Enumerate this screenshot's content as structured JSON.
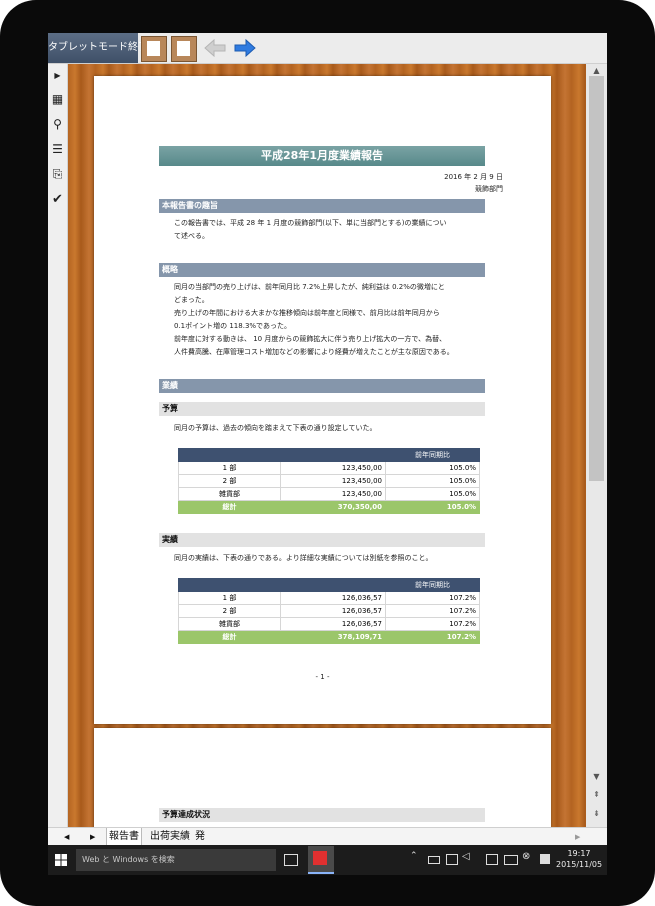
{
  "toolbar": {
    "tablet_mode_label": "タブレットモード終了"
  },
  "report": {
    "title": "平成28年1月度業績報告",
    "date": "2016 年 2 月 9 日",
    "department": "競飾部門",
    "section_purpose": {
      "heading": "本報告書の趣旨",
      "lines": [
        "この報告書では、平成 28 年 1 月度の競飾部門(以下、単に当部門とする)の業績につい",
        "て述べる。"
      ]
    },
    "section_summary": {
      "heading": "概略",
      "lines": [
        "同月の当部門の売り上げは、前年同月比 7.2%上昇したが、純利益は 0.2%の微増にと",
        "どまった。",
        "売り上げの年間における大まかな推移傾向は前年度と同様で、前月比は前年同月から",
        "0.1ポイント増の 118.3%であった。",
        "前年度に対する動きは、 10 月度からの競飾拡大に伴う売り上げ拡大の一方で、為替、",
        "人件費高騰、在庫管理コスト増加などの影響により経費が増えたことが主な原因である。"
      ]
    },
    "section_results": {
      "heading": "業績"
    },
    "budget": {
      "heading": "予算",
      "text": "同月の予算は、過去の傾向を踏まえて下表の通り設定していた。",
      "header": [
        "",
        "",
        "前年同期比"
      ],
      "rows": [
        [
          "1 部",
          "123,450,00",
          "105.0%"
        ],
        [
          "2 部",
          "123,450,00",
          "105.0%"
        ],
        [
          "雑貨部",
          "123,450,00",
          "105.0%"
        ]
      ],
      "total": [
        "総計",
        "370,350,00",
        "105.0%"
      ]
    },
    "actual": {
      "heading": "実績",
      "text": "同月の実績は、下表の通りである。より詳細な実績については別紙を参照のこと。",
      "header": [
        "",
        "",
        "前年同期比"
      ],
      "rows": [
        [
          "1 部",
          "126,036,57",
          "107.2%"
        ],
        [
          "2 部",
          "126,036,57",
          "107.2%"
        ],
        [
          "雑貨部",
          "126,036,57",
          "107.2%"
        ]
      ],
      "total": [
        "総計",
        "378,109,71",
        "107.2%"
      ]
    },
    "page_number": "- 1 -",
    "next_page_heading": "予算達成状況"
  },
  "tabs": [
    "報告書",
    "出荷実績",
    "発"
  ],
  "taskbar": {
    "search_placeholder": "Web と Windows を検索",
    "time": "19:17",
    "date": "2015/11/05"
  },
  "colors": {
    "title_bar": "#5f8f90",
    "section_bar": "#8596ab",
    "table_header": "#3e5170",
    "table_total": "#9bc66a",
    "wood": "#b56522"
  }
}
